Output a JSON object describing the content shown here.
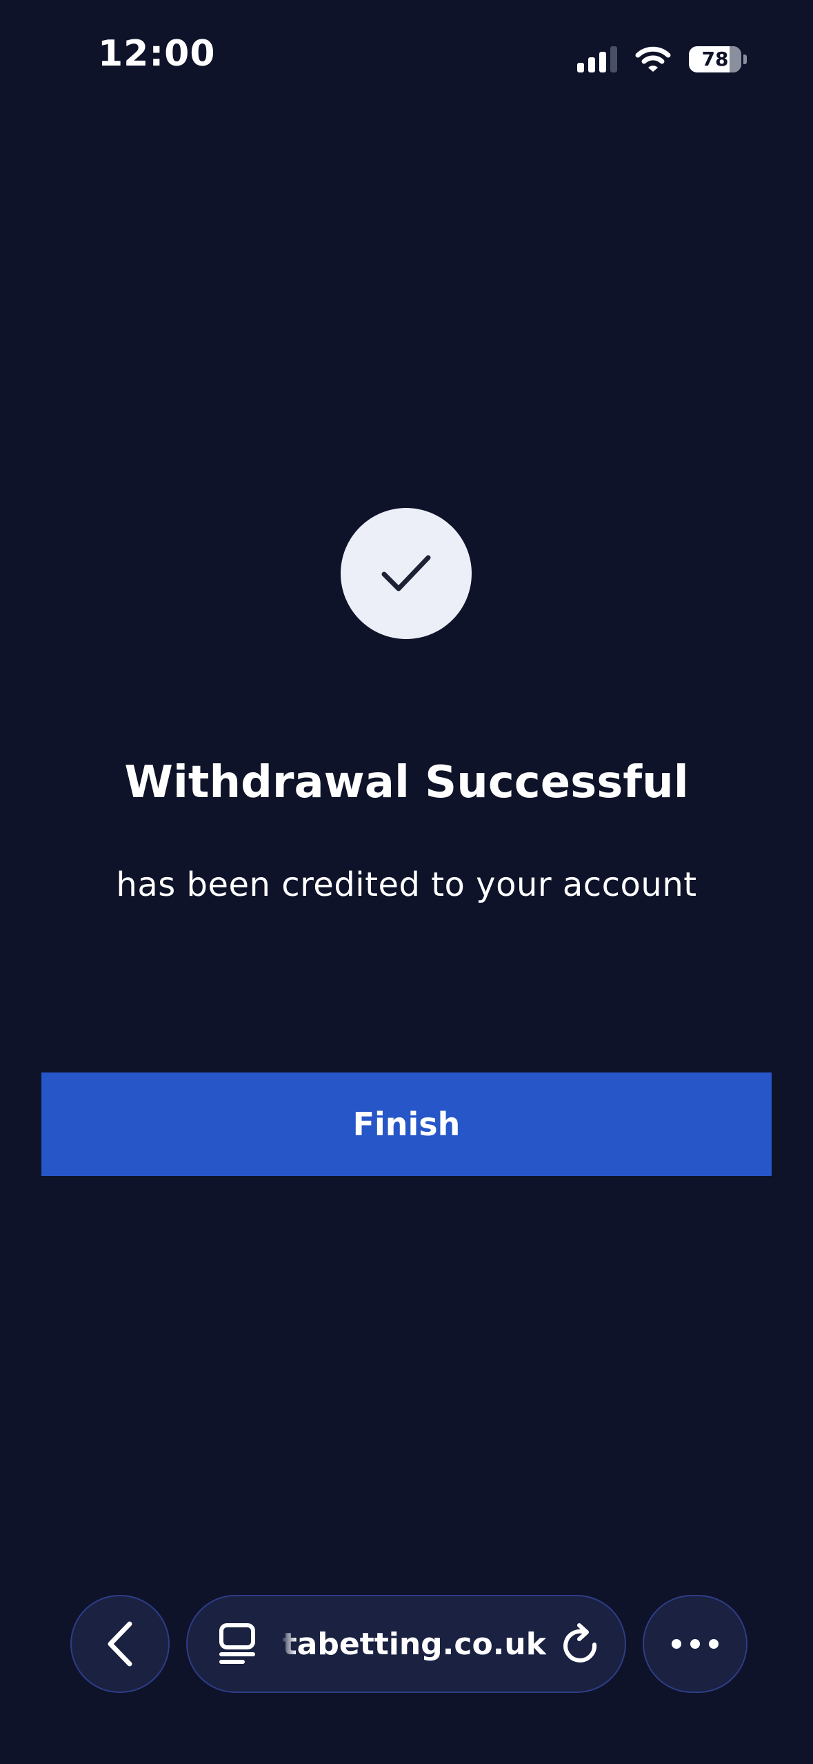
{
  "status_bar": {
    "time": "12:00",
    "battery_level": "78",
    "icons": [
      "cellular-signal-icon",
      "wifi-icon",
      "battery-icon"
    ]
  },
  "main": {
    "icon": "checkmark-icon",
    "title": "Withdrawal Successful",
    "subtitle": "has been credited to your account",
    "finish_label": "Finish"
  },
  "browser_bar": {
    "url": "betabetting.co.uk",
    "icons": [
      "back-chevron-icon",
      "tabs-icon",
      "reload-icon",
      "more-icon"
    ]
  },
  "colors": {
    "background": "#0e1329",
    "accent": "#2656c8",
    "icon_circle": "#eceff8",
    "bar_fill": "#1a2141",
    "bar_border": "#2e3d86"
  }
}
